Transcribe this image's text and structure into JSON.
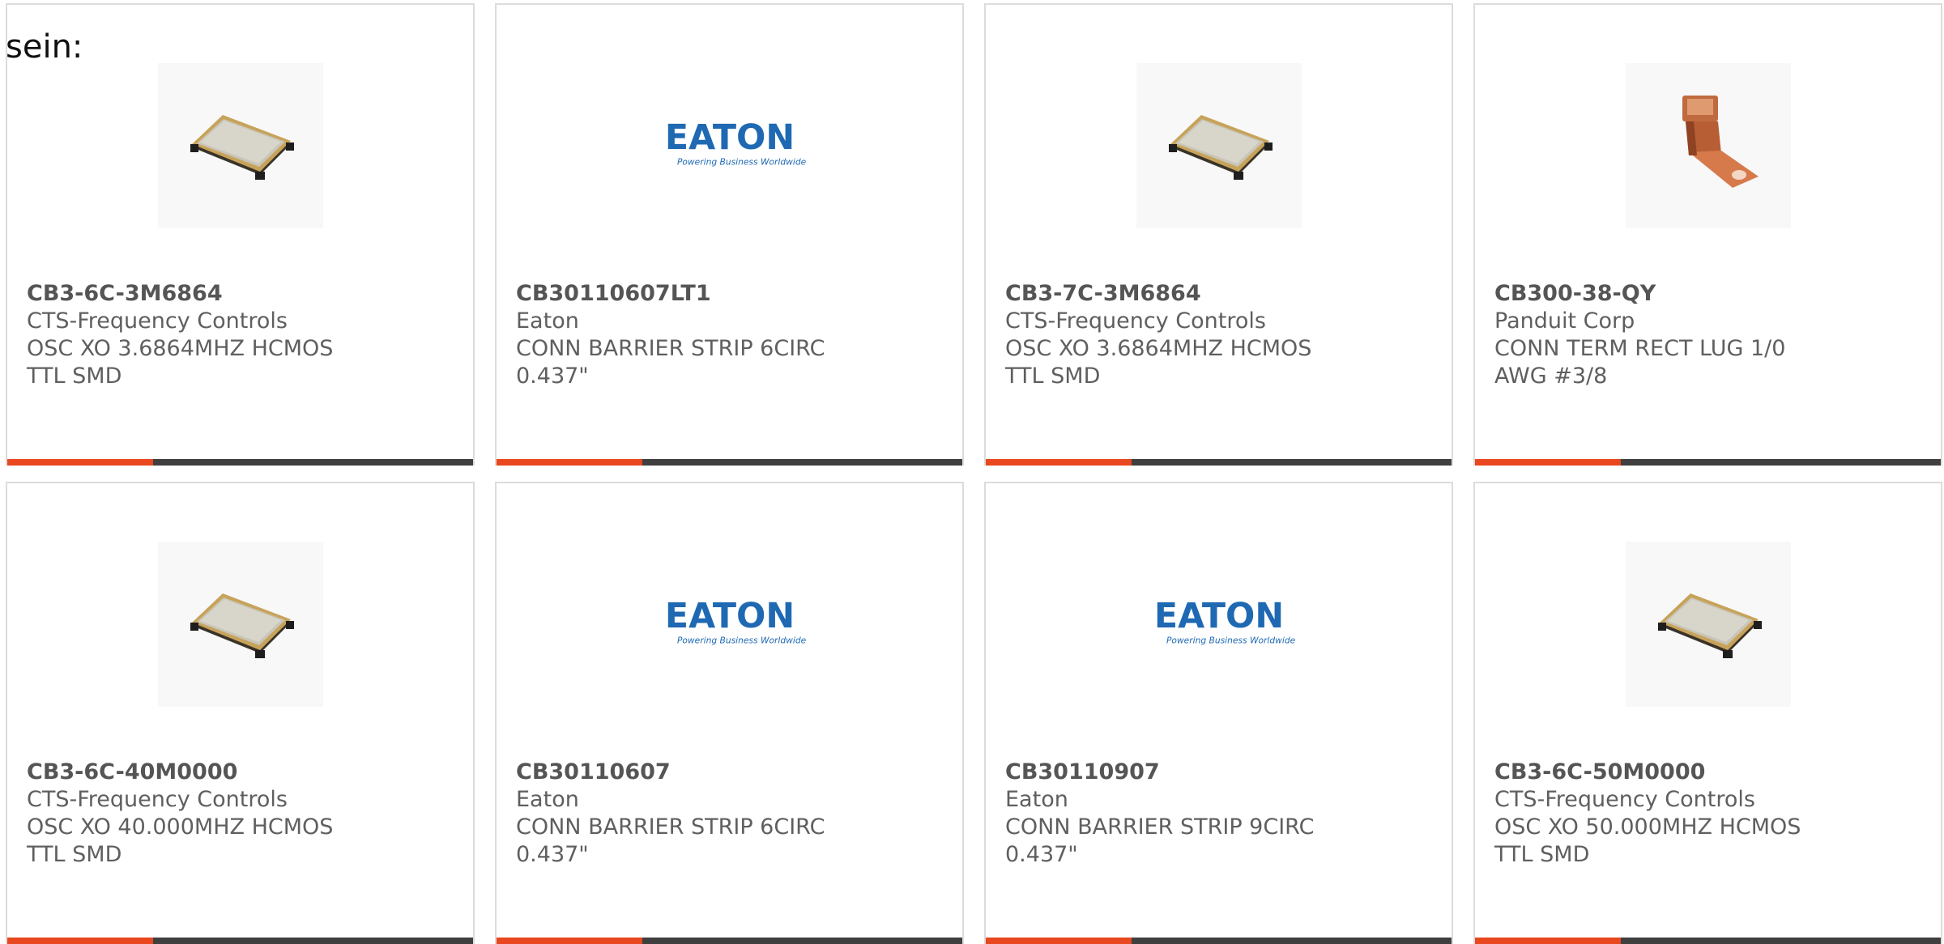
{
  "intro_text": "sein:",
  "colors": {
    "accent_bar": "#e8471f",
    "dark_bar": "#3f3f3f",
    "eaton_blue": "#1f69b3"
  },
  "products": [
    {
      "part_number": "CB3-6C-3M6864",
      "manufacturer": "CTS-Frequency Controls",
      "description": "OSC XO 3.6864MHZ HCMOS TTL SMD",
      "image": "oscillator-chip-image"
    },
    {
      "part_number": "CB30110607LT1",
      "manufacturer": "Eaton",
      "description": "CONN BARRIER STRIP 6CIRC 0.437\"",
      "image": "eaton-logo",
      "logo_text": "EATON",
      "logo_tagline": "Powering Business Worldwide"
    },
    {
      "part_number": "CB3-7C-3M6864",
      "manufacturer": "CTS-Frequency Controls",
      "description": "OSC XO 3.6864MHZ HCMOS TTL SMD",
      "image": "oscillator-chip-image"
    },
    {
      "part_number": "CB300-38-QY",
      "manufacturer": "Panduit Corp",
      "description": "CONN TERM RECT LUG 1/0 AWG #3/8",
      "image": "copper-lug-image"
    },
    {
      "part_number": "CB3-6C-40M0000",
      "manufacturer": "CTS-Frequency Controls",
      "description": "OSC XO 40.000MHZ HCMOS TTL SMD",
      "image": "oscillator-chip-image"
    },
    {
      "part_number": "CB30110607",
      "manufacturer": "Eaton",
      "description": "CONN BARRIER STRIP 6CIRC 0.437\"",
      "image": "eaton-logo",
      "logo_text": "EATON",
      "logo_tagline": "Powering Business Worldwide"
    },
    {
      "part_number": "CB30110907",
      "manufacturer": "Eaton",
      "description": "CONN BARRIER STRIP 9CIRC 0.437\"",
      "image": "eaton-logo",
      "logo_text": "EATON",
      "logo_tagline": "Powering Business Worldwide"
    },
    {
      "part_number": "CB3-6C-50M0000",
      "manufacturer": "CTS-Frequency Controls",
      "description": "OSC XO 50.000MHZ HCMOS TTL SMD",
      "image": "oscillator-chip-image"
    }
  ]
}
